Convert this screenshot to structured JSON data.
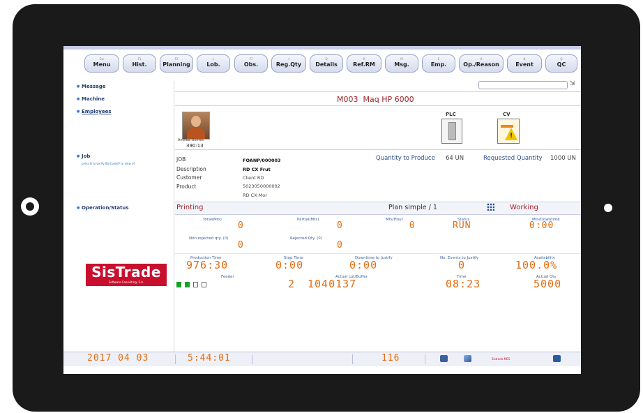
{
  "toolbar": [
    {
      "key": "Esc",
      "label": "Menu"
    },
    {
      "key": "F1",
      "label": "Hist."
    },
    {
      "key": "F2",
      "label": "Planning"
    },
    {
      "key": "L",
      "label": "Lob."
    },
    {
      "key": "F7",
      "label": "Obs."
    },
    {
      "key": "+",
      "label": "Reg.Qty"
    },
    {
      "key": "D",
      "label": "Details"
    },
    {
      "key": "R",
      "label": "Ref.RM"
    },
    {
      "key": "M",
      "label": "Msg."
    },
    {
      "key": "E",
      "label": "Emp."
    },
    {
      "key": "O",
      "label": "Op./Reason"
    },
    {
      "key": "N",
      "label": "Event"
    },
    {
      "key": "Q",
      "label": "QC"
    }
  ],
  "sidebar": {
    "message": "Message",
    "machine": "Machine",
    "employees": "Employees",
    "job": "Job",
    "job_hint": "press B to verify BarCode/V to view of",
    "operation": "Operation/Status"
  },
  "logo": {
    "name": "SisTrade",
    "tagline": "Software Consulting, S.A."
  },
  "machine": {
    "code": "M003",
    "name": "Maq HP 6000"
  },
  "employee": {
    "name": "Andrea Gomes",
    "number": "390:13"
  },
  "icons": {
    "plc": "PLC",
    "cv": "CV"
  },
  "job": {
    "labels": {
      "job": "JOB",
      "description": "Description",
      "customer": "Customer",
      "product": "Product"
    },
    "values": {
      "job": "FOANP/000003",
      "description": "RD CX Frut",
      "customer": "Client RD",
      "product": "5023050000002",
      "product_desc": "RD CX Mor"
    }
  },
  "quantities": {
    "to_produce_label": "Quantity to Produce",
    "to_produce": "64 UN",
    "requested_label": "Requested Quantity",
    "requested": "1000 UN"
  },
  "operation": {
    "name": "Printing",
    "plan": "Plan simple / 1",
    "state": "Working"
  },
  "metrics": {
    "total_label": "Total(Mts)",
    "total": "0",
    "partial_label": "Partial(Mts)",
    "partial": "0",
    "mts_hour_label": "Mts/Hour",
    "mts_hour": "0",
    "status_label": "Status",
    "status": "RUN",
    "min_down_label": "Min/Downtime",
    "min_down": "0:00",
    "non_rejected_label": "Non rejected qty. (0)",
    "non_rejected": "0",
    "rejected_label": "Rejected Qty. (0)",
    "rejected": "0",
    "prod_time_label": "Production Time",
    "prod_time": "976:30",
    "stop_time_label": "Stop Time",
    "stop_time": "0:00",
    "downtime_label": "Downtime to Justify",
    "downtime": "0:00",
    "events_label": "No. Events to Justify",
    "events": "0",
    "availability_label": "Availability",
    "availability": "100.0%",
    "feeder_label": "Feeder",
    "feeder": "2",
    "lot_label": "Actual Lot/Buffer",
    "lot": "1040137",
    "time_label": "Time",
    "time": "08:23",
    "actual_qty_label": "Actual Qty",
    "actual_qty": "5000"
  },
  "feeder_indicators": [
    true,
    true,
    false,
    false
  ],
  "statusbar": {
    "date": "2017 04 03",
    "clock": "5:44:01",
    "count": "116",
    "brand": "Sistrade MES"
  },
  "colors": {
    "led": "#e36b0d",
    "accent": "#a0242c",
    "logo": "#c8102e"
  }
}
